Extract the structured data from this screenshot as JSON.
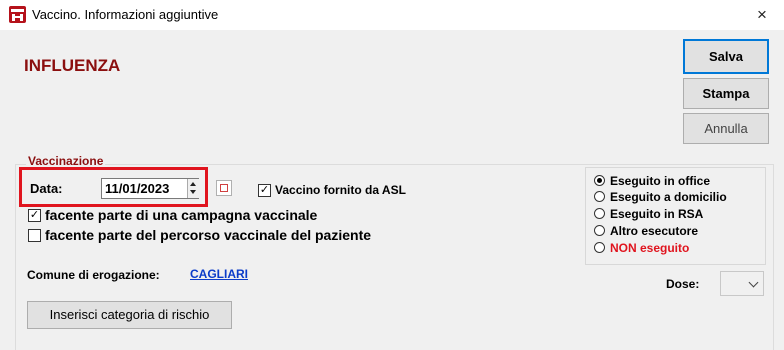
{
  "window": {
    "title": "Vaccino. Informazioni aggiuntive",
    "close_glyph": "×",
    "app_icon": "castle-icon",
    "app_icon_color": "#b5121b"
  },
  "heading": "INFLUENZA",
  "buttons": {
    "save": "Salva",
    "print": "Stampa",
    "cancel": "Annulla",
    "risk_category": "Inserisci categoria di rischio"
  },
  "vaccination": {
    "group_label": "Vaccinazione",
    "date_label": "Data:",
    "date_value": "11/01/2023",
    "asl_checkbox": {
      "label": "Vaccino fornito da ASL",
      "checked": true
    },
    "campaign_checkbox": {
      "label": "facente parte di una campagna vaccinale",
      "checked": true
    },
    "path_checkbox": {
      "label": "facente parte del percorso vaccinale del paziente",
      "checked": false
    }
  },
  "executor": {
    "options": [
      {
        "label": "Eseguito in office",
        "checked": true
      },
      {
        "label": "Eseguito a domicilio",
        "checked": false
      },
      {
        "label": "Eseguito in RSA",
        "checked": false
      },
      {
        "label": "Altro esecutore",
        "checked": false
      },
      {
        "label": "NON eseguito",
        "checked": false,
        "color": "#e0141e"
      }
    ]
  },
  "comune": {
    "label": "Comune di erogazione:",
    "value": "CAGLIARI"
  },
  "dose": {
    "label": "Dose:",
    "value": ""
  },
  "colors": {
    "heading": "#8b0f0f",
    "link": "#0b3cc9",
    "highlight": "#e0141e",
    "focus_border": "#0078d7"
  }
}
